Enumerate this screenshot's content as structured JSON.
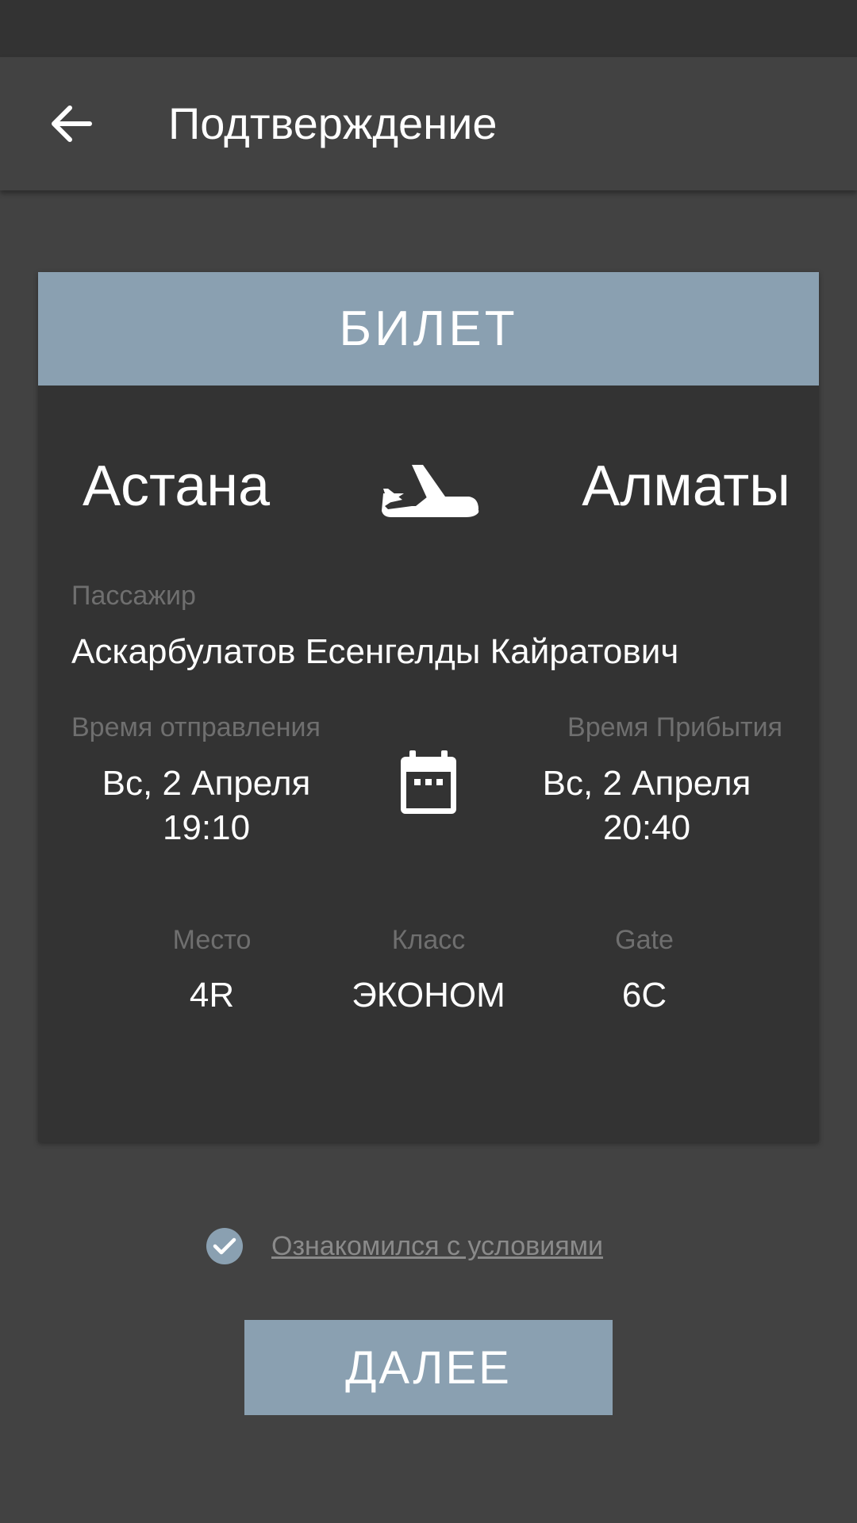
{
  "app_bar": {
    "title": "Подтверждение",
    "back_icon": "arrow-left-icon"
  },
  "ticket": {
    "header": "БИЛЕТ",
    "from_city": "Астана",
    "to_city": "Алматы",
    "route_icon": "airplane-icon",
    "passenger_label": "Пассажир",
    "passenger_name": "Аскарбулатов Есенгелды Кайратович",
    "departure_label": "Время отправления",
    "departure_date": "Вс, 2 Апреля",
    "departure_time": "19:10",
    "arrival_label": "Время Прибытия",
    "arrival_date": "Вс, 2 Апреля",
    "arrival_time": "20:40",
    "calendar_icon": "calendar-icon",
    "seat_label": "Место",
    "seat_value": "4R",
    "class_label": "Класс",
    "class_value": "ЭКОНОМ",
    "gate_label": "Gate",
    "gate_value": "6C"
  },
  "terms": {
    "text": "Ознакомился с условиями",
    "checked": true
  },
  "next_button": {
    "label": "ДАЛЕЕ"
  },
  "colors": {
    "background": "#424242",
    "status_bar": "#333333",
    "card": "#333333",
    "accent": "#8aa0b1",
    "muted_text": "#6f6f6f"
  }
}
